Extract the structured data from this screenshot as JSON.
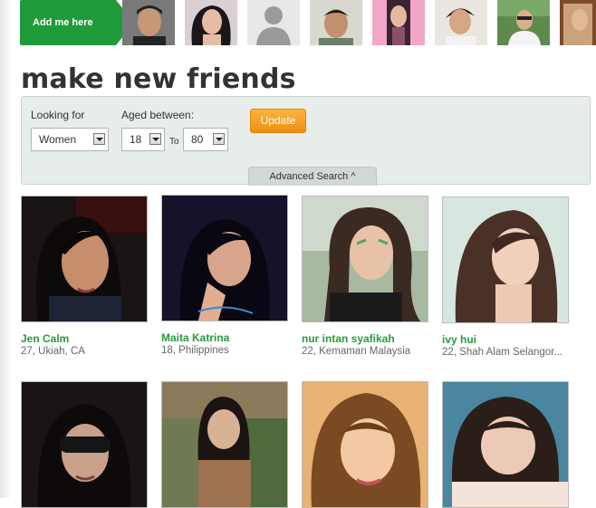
{
  "strip": {
    "add_me_label": "Add me here"
  },
  "section": {
    "title": "make new friends"
  },
  "search": {
    "looking_for_label": "Looking for",
    "looking_for_value": "Women",
    "aged_between_label": "Aged between:",
    "age_min": "18",
    "age_to_label": "To",
    "age_max": "80",
    "update_label": "Update",
    "advanced_label": "Advanced Search ^"
  },
  "profiles": [
    {
      "name": "Jen Calm",
      "info": "27, Ukiah, CA"
    },
    {
      "name": "Maita Katrina",
      "info": "18, Philippines"
    },
    {
      "name": "nur intan syafikah",
      "info": "22, Kemaman Malaysia"
    },
    {
      "name": "ivy hui",
      "info": "22, Shah Alam Selangor..."
    }
  ],
  "colors": {
    "accent_green": "#1f9a3b",
    "name_green": "#2a9a3c",
    "update_orange": "#f59e1e",
    "panel_bg": "#e7ede9"
  }
}
